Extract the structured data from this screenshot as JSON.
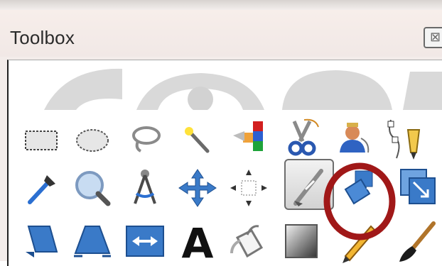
{
  "window": {
    "title": "Toolbox",
    "close_glyph": "⊠"
  },
  "tools": {
    "row1": [
      {
        "name": "rect-select-icon"
      },
      {
        "name": "ellipse-select-icon"
      },
      {
        "name": "free-select-lasso-icon"
      },
      {
        "name": "fuzzy-select-wand-icon"
      },
      {
        "name": "select-by-color-icon"
      },
      {
        "name": "scissors-select-icon"
      },
      {
        "name": "foreground-select-icon"
      },
      {
        "name": "paths-tool-icon"
      }
    ],
    "row2": [
      {
        "name": "color-picker-icon"
      },
      {
        "name": "zoom-icon"
      },
      {
        "name": "measure-icon"
      },
      {
        "name": "move-icon"
      },
      {
        "name": "align-icon"
      },
      {
        "name": "crop-icon",
        "active": true
      },
      {
        "name": "rotate-icon",
        "highlighted": true
      },
      {
        "name": "scale-icon"
      }
    ],
    "row3": [
      {
        "name": "shear-icon"
      },
      {
        "name": "perspective-icon"
      },
      {
        "name": "flip-icon"
      },
      {
        "name": "text-icon",
        "label": "A"
      },
      {
        "name": "bucket-fill-icon"
      },
      {
        "name": "blend-icon"
      },
      {
        "name": "pencil-icon"
      },
      {
        "name": "paintbrush-icon"
      }
    ]
  },
  "annotation": {
    "ring_color": "#a01818"
  },
  "colors": {
    "tool_blue": "#3a7ac8",
    "title_bg": "#f3ecea"
  }
}
